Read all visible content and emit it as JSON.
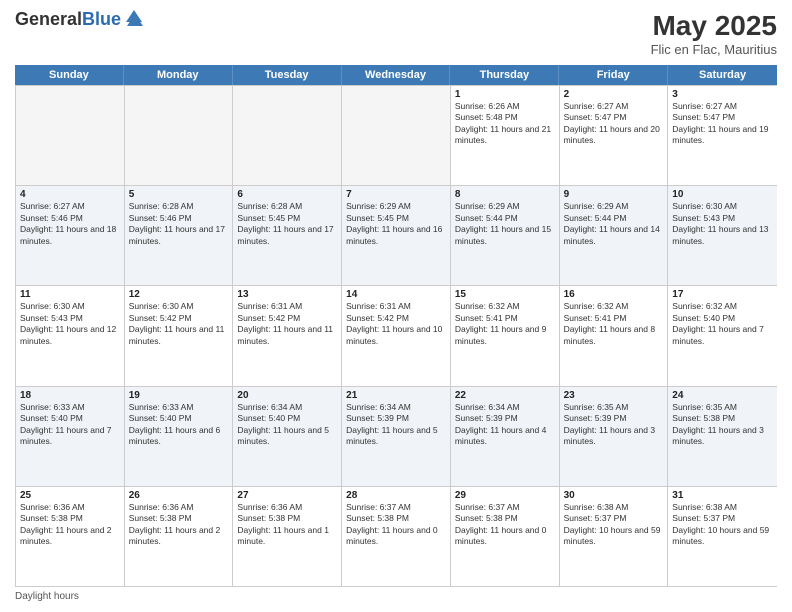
{
  "header": {
    "logo_general": "General",
    "logo_blue": "Blue",
    "title": "May 2025",
    "subtitle": "Flic en Flac, Mauritius"
  },
  "days_of_week": [
    "Sunday",
    "Monday",
    "Tuesday",
    "Wednesday",
    "Thursday",
    "Friday",
    "Saturday"
  ],
  "weeks": [
    [
      {
        "day": "",
        "info": ""
      },
      {
        "day": "",
        "info": ""
      },
      {
        "day": "",
        "info": ""
      },
      {
        "day": "",
        "info": ""
      },
      {
        "day": "1",
        "info": "Sunrise: 6:26 AM\nSunset: 5:48 PM\nDaylight: 11 hours and 21 minutes."
      },
      {
        "day": "2",
        "info": "Sunrise: 6:27 AM\nSunset: 5:47 PM\nDaylight: 11 hours and 20 minutes."
      },
      {
        "day": "3",
        "info": "Sunrise: 6:27 AM\nSunset: 5:47 PM\nDaylight: 11 hours and 19 minutes."
      }
    ],
    [
      {
        "day": "4",
        "info": "Sunrise: 6:27 AM\nSunset: 5:46 PM\nDaylight: 11 hours and 18 minutes."
      },
      {
        "day": "5",
        "info": "Sunrise: 6:28 AM\nSunset: 5:46 PM\nDaylight: 11 hours and 17 minutes."
      },
      {
        "day": "6",
        "info": "Sunrise: 6:28 AM\nSunset: 5:45 PM\nDaylight: 11 hours and 17 minutes."
      },
      {
        "day": "7",
        "info": "Sunrise: 6:29 AM\nSunset: 5:45 PM\nDaylight: 11 hours and 16 minutes."
      },
      {
        "day": "8",
        "info": "Sunrise: 6:29 AM\nSunset: 5:44 PM\nDaylight: 11 hours and 15 minutes."
      },
      {
        "day": "9",
        "info": "Sunrise: 6:29 AM\nSunset: 5:44 PM\nDaylight: 11 hours and 14 minutes."
      },
      {
        "day": "10",
        "info": "Sunrise: 6:30 AM\nSunset: 5:43 PM\nDaylight: 11 hours and 13 minutes."
      }
    ],
    [
      {
        "day": "11",
        "info": "Sunrise: 6:30 AM\nSunset: 5:43 PM\nDaylight: 11 hours and 12 minutes."
      },
      {
        "day": "12",
        "info": "Sunrise: 6:30 AM\nSunset: 5:42 PM\nDaylight: 11 hours and 11 minutes."
      },
      {
        "day": "13",
        "info": "Sunrise: 6:31 AM\nSunset: 5:42 PM\nDaylight: 11 hours and 11 minutes."
      },
      {
        "day": "14",
        "info": "Sunrise: 6:31 AM\nSunset: 5:42 PM\nDaylight: 11 hours and 10 minutes."
      },
      {
        "day": "15",
        "info": "Sunrise: 6:32 AM\nSunset: 5:41 PM\nDaylight: 11 hours and 9 minutes."
      },
      {
        "day": "16",
        "info": "Sunrise: 6:32 AM\nSunset: 5:41 PM\nDaylight: 11 hours and 8 minutes."
      },
      {
        "day": "17",
        "info": "Sunrise: 6:32 AM\nSunset: 5:40 PM\nDaylight: 11 hours and 7 minutes."
      }
    ],
    [
      {
        "day": "18",
        "info": "Sunrise: 6:33 AM\nSunset: 5:40 PM\nDaylight: 11 hours and 7 minutes."
      },
      {
        "day": "19",
        "info": "Sunrise: 6:33 AM\nSunset: 5:40 PM\nDaylight: 11 hours and 6 minutes."
      },
      {
        "day": "20",
        "info": "Sunrise: 6:34 AM\nSunset: 5:40 PM\nDaylight: 11 hours and 5 minutes."
      },
      {
        "day": "21",
        "info": "Sunrise: 6:34 AM\nSunset: 5:39 PM\nDaylight: 11 hours and 5 minutes."
      },
      {
        "day": "22",
        "info": "Sunrise: 6:34 AM\nSunset: 5:39 PM\nDaylight: 11 hours and 4 minutes."
      },
      {
        "day": "23",
        "info": "Sunrise: 6:35 AM\nSunset: 5:39 PM\nDaylight: 11 hours and 3 minutes."
      },
      {
        "day": "24",
        "info": "Sunrise: 6:35 AM\nSunset: 5:38 PM\nDaylight: 11 hours and 3 minutes."
      }
    ],
    [
      {
        "day": "25",
        "info": "Sunrise: 6:36 AM\nSunset: 5:38 PM\nDaylight: 11 hours and 2 minutes."
      },
      {
        "day": "26",
        "info": "Sunrise: 6:36 AM\nSunset: 5:38 PM\nDaylight: 11 hours and 2 minutes."
      },
      {
        "day": "27",
        "info": "Sunrise: 6:36 AM\nSunset: 5:38 PM\nDaylight: 11 hours and 1 minute."
      },
      {
        "day": "28",
        "info": "Sunrise: 6:37 AM\nSunset: 5:38 PM\nDaylight: 11 hours and 0 minutes."
      },
      {
        "day": "29",
        "info": "Sunrise: 6:37 AM\nSunset: 5:38 PM\nDaylight: 11 hours and 0 minutes."
      },
      {
        "day": "30",
        "info": "Sunrise: 6:38 AM\nSunset: 5:37 PM\nDaylight: 10 hours and 59 minutes."
      },
      {
        "day": "31",
        "info": "Sunrise: 6:38 AM\nSunset: 5:37 PM\nDaylight: 10 hours and 59 minutes."
      }
    ]
  ],
  "footer": {
    "daylight_label": "Daylight hours"
  },
  "colors": {
    "header_bg": "#3d7ab5",
    "alt_row_bg": "#f0f4f8",
    "empty_bg": "#f5f5f5"
  }
}
